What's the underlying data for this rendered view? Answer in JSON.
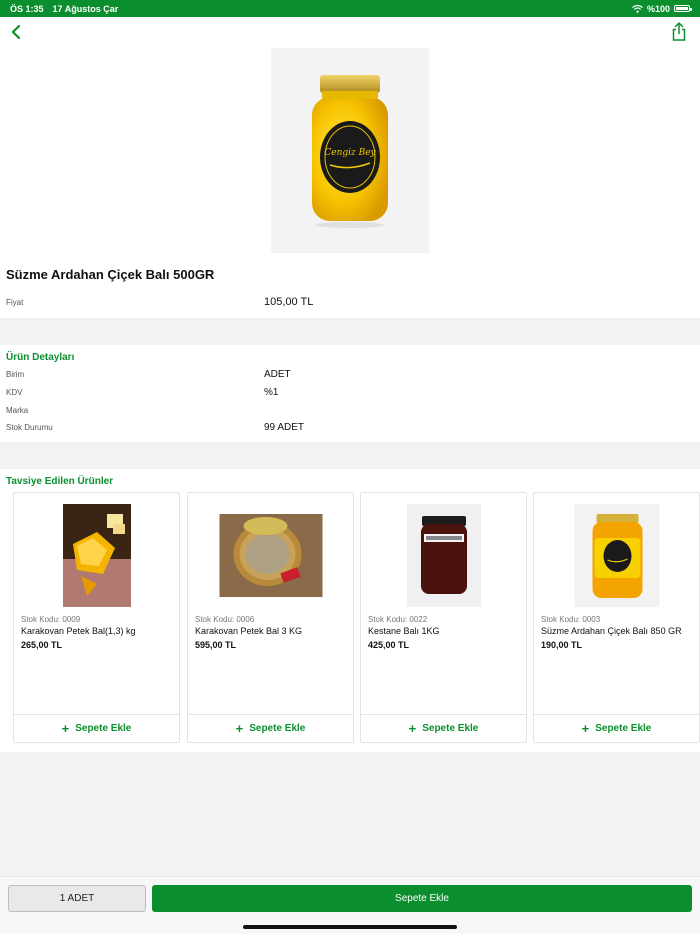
{
  "status_bar": {
    "time": "ÖS 1:35",
    "date": "17 Ağustos Çar",
    "battery": "%100",
    "battery_level": 1.0
  },
  "nav": {
    "back_icon": "chevron-left-icon",
    "share_icon": "share-icon"
  },
  "product": {
    "title": "Süzme Ardahan Çiçek Balı 500GR",
    "price_label": "Fiyat",
    "price_value": "105,00 TL",
    "brand_text": "Cengiz Bey"
  },
  "details": {
    "title": "Ürün Detayları",
    "rows": [
      {
        "label": "Birim",
        "value": "ADET"
      },
      {
        "label": "KDV",
        "value": "%1"
      },
      {
        "label": "Marka",
        "value": ""
      },
      {
        "label": "Stok Durumu",
        "value": "99 ADET"
      }
    ]
  },
  "recommended": {
    "title": "Tavsiye Edilen Ürünler",
    "add_label": "Sepete Ekle",
    "items": [
      {
        "sku": "Stok Kodu: 0009",
        "name": "Karakovan Petek Bal(1,3) kg",
        "price": "265,00 TL"
      },
      {
        "sku": "Stok Kodu: 0006",
        "name": "Karakovan Petek Bal 3 KG",
        "price": "595,00 TL"
      },
      {
        "sku": "Stok Kodu: 0022",
        "name": "Kestane Balı 1KG",
        "price": "425,00 TL"
      },
      {
        "sku": "Stok Kodu: 0003",
        "name": "Süzme Ardahan Çiçek Balı 850 GR",
        "price": "190,00 TL"
      }
    ]
  },
  "bottom": {
    "qty_label": "1 ADET",
    "add_to_cart_label": "Sepete Ekle"
  },
  "colors": {
    "accent": "#0b8f2e",
    "band": "#f2f2f4"
  }
}
